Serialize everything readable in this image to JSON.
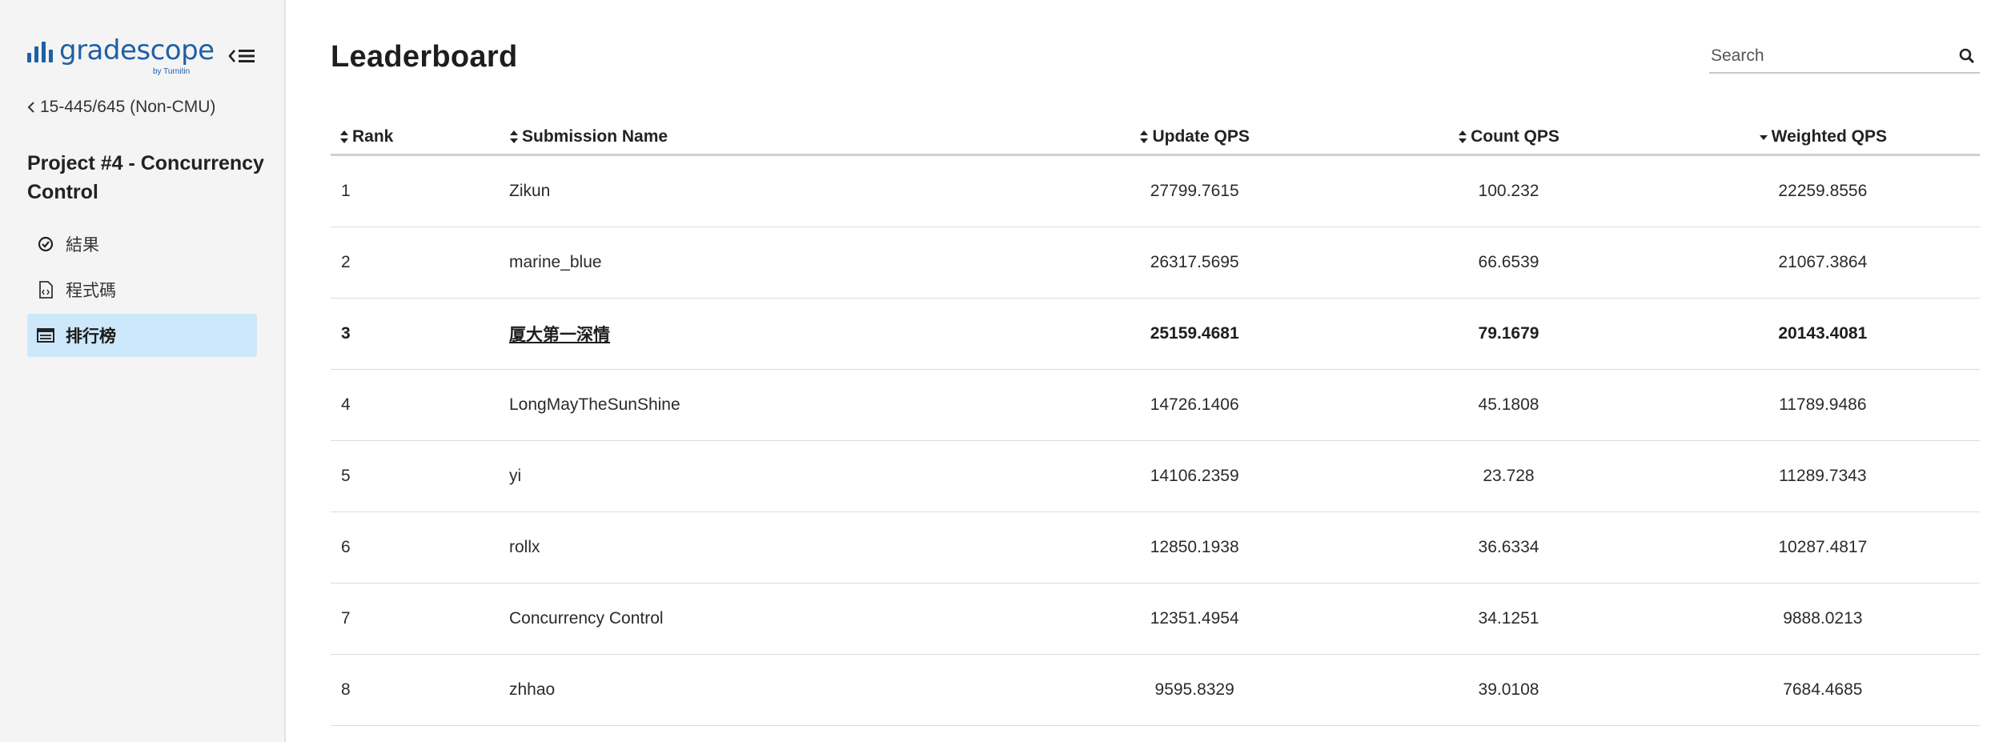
{
  "sidebar": {
    "logo_text": "gradescope",
    "logo_sub": "by Turnitin",
    "course_link": "15-445/645 (Non-CMU)",
    "assignment_title": "Project #4 - Concurrency Control",
    "nav": [
      {
        "label": "結果",
        "icon": "check-circle-icon"
      },
      {
        "label": "程式碼",
        "icon": "code-file-icon"
      },
      {
        "label": "排行榜",
        "icon": "leaderboard-icon",
        "active": true
      }
    ]
  },
  "main": {
    "title": "Leaderboard",
    "search_placeholder": "Search"
  },
  "table": {
    "headers": {
      "rank": "Rank",
      "name": "Submission Name",
      "update": "Update QPS",
      "count": "Count QPS",
      "weighted": "Weighted QPS"
    },
    "sorted_column": "weighted",
    "sort_direction": "descending",
    "rows": [
      {
        "rank": "1",
        "name": "Zikun",
        "update": "27799.7615",
        "count": "100.232",
        "weighted": "22259.8556"
      },
      {
        "rank": "2",
        "name": "marine_blue",
        "update": "26317.5695",
        "count": "66.6539",
        "weighted": "21067.3864"
      },
      {
        "rank": "3",
        "name": "厦大第一深情",
        "update": "25159.4681",
        "count": "79.1679",
        "weighted": "20143.4081",
        "highlight": true
      },
      {
        "rank": "4",
        "name": "LongMayTheSunShine",
        "update": "14726.1406",
        "count": "45.1808",
        "weighted": "11789.9486"
      },
      {
        "rank": "5",
        "name": "yi",
        "update": "14106.2359",
        "count": "23.728",
        "weighted": "11289.7343"
      },
      {
        "rank": "6",
        "name": "rollx",
        "update": "12850.1938",
        "count": "36.6334",
        "weighted": "10287.4817"
      },
      {
        "rank": "7",
        "name": "Concurrency Control",
        "update": "12351.4954",
        "count": "34.1251",
        "weighted": "9888.0213"
      },
      {
        "rank": "8",
        "name": "zhhao",
        "update": "9595.8329",
        "count": "39.0108",
        "weighted": "7684.4685"
      }
    ]
  },
  "colors": {
    "brand": "#1f5fa6",
    "active_nav_bg": "#cde8fb",
    "sidebar_bg": "#f4f4f4"
  }
}
